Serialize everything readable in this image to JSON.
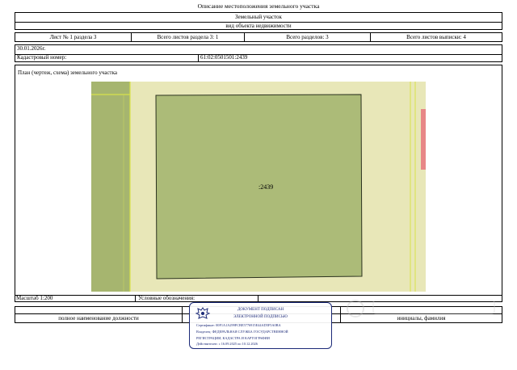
{
  "document": {
    "title": "Описание местоположения земельного участка",
    "object_label": "Земельный участок",
    "object_sublabel": "вид объекта недвижимости",
    "sheet_info": {
      "sheet": "Лист № 1 раздела 3",
      "sheets_in_section": "Всего листов раздела 3: 1",
      "sections_total": "Всего разделов: 3",
      "sheets_in_extract": "Всего листов выписки: 4"
    },
    "date": "30.01.2026г.",
    "cadastral_label": "Кадастровый номер:",
    "cadastral_number": "61:02:0501501:2439",
    "plan_label": "План (чертеж, схема) земельного участка",
    "map": {
      "parcel_label": ":2439",
      "colors": {
        "background": "#e8e7b8",
        "parcel": "#acbb78",
        "neighbor": "#a6b56f",
        "highlight": "#e88787",
        "border_line": "#d8e24a",
        "outline": "#2c3320"
      }
    },
    "scale": "Масштаб 1:200",
    "legend_label": "Условные обозначения:",
    "footer": {
      "position_label": "полное наименование должности",
      "name_label": "инициалы, фамилия"
    },
    "stamp": {
      "icon": "eagle-emblem-icon",
      "title": "ДОКУМЕНТ ПОДПИСАН",
      "subtitle": "ЭЛЕКТРОННОЙ ПОДПИСЬЮ",
      "certificate": "Сертификат: 00F1A1A299FCBE5776915E44AD5F5A0BA",
      "owner_line1": "Владелец: ФЕДЕРАЛЬНАЯ СЛУЖБА ГОСУДАРСТВЕННОЙ",
      "owner_line2": "РЕГИСТРАЦИИ, КАДАСТРА И КАРТОГРАФИИ",
      "validity": "Действителен: с 16.09.2025 по 10.12.2026",
      "color": "#1c2a78"
    }
  }
}
